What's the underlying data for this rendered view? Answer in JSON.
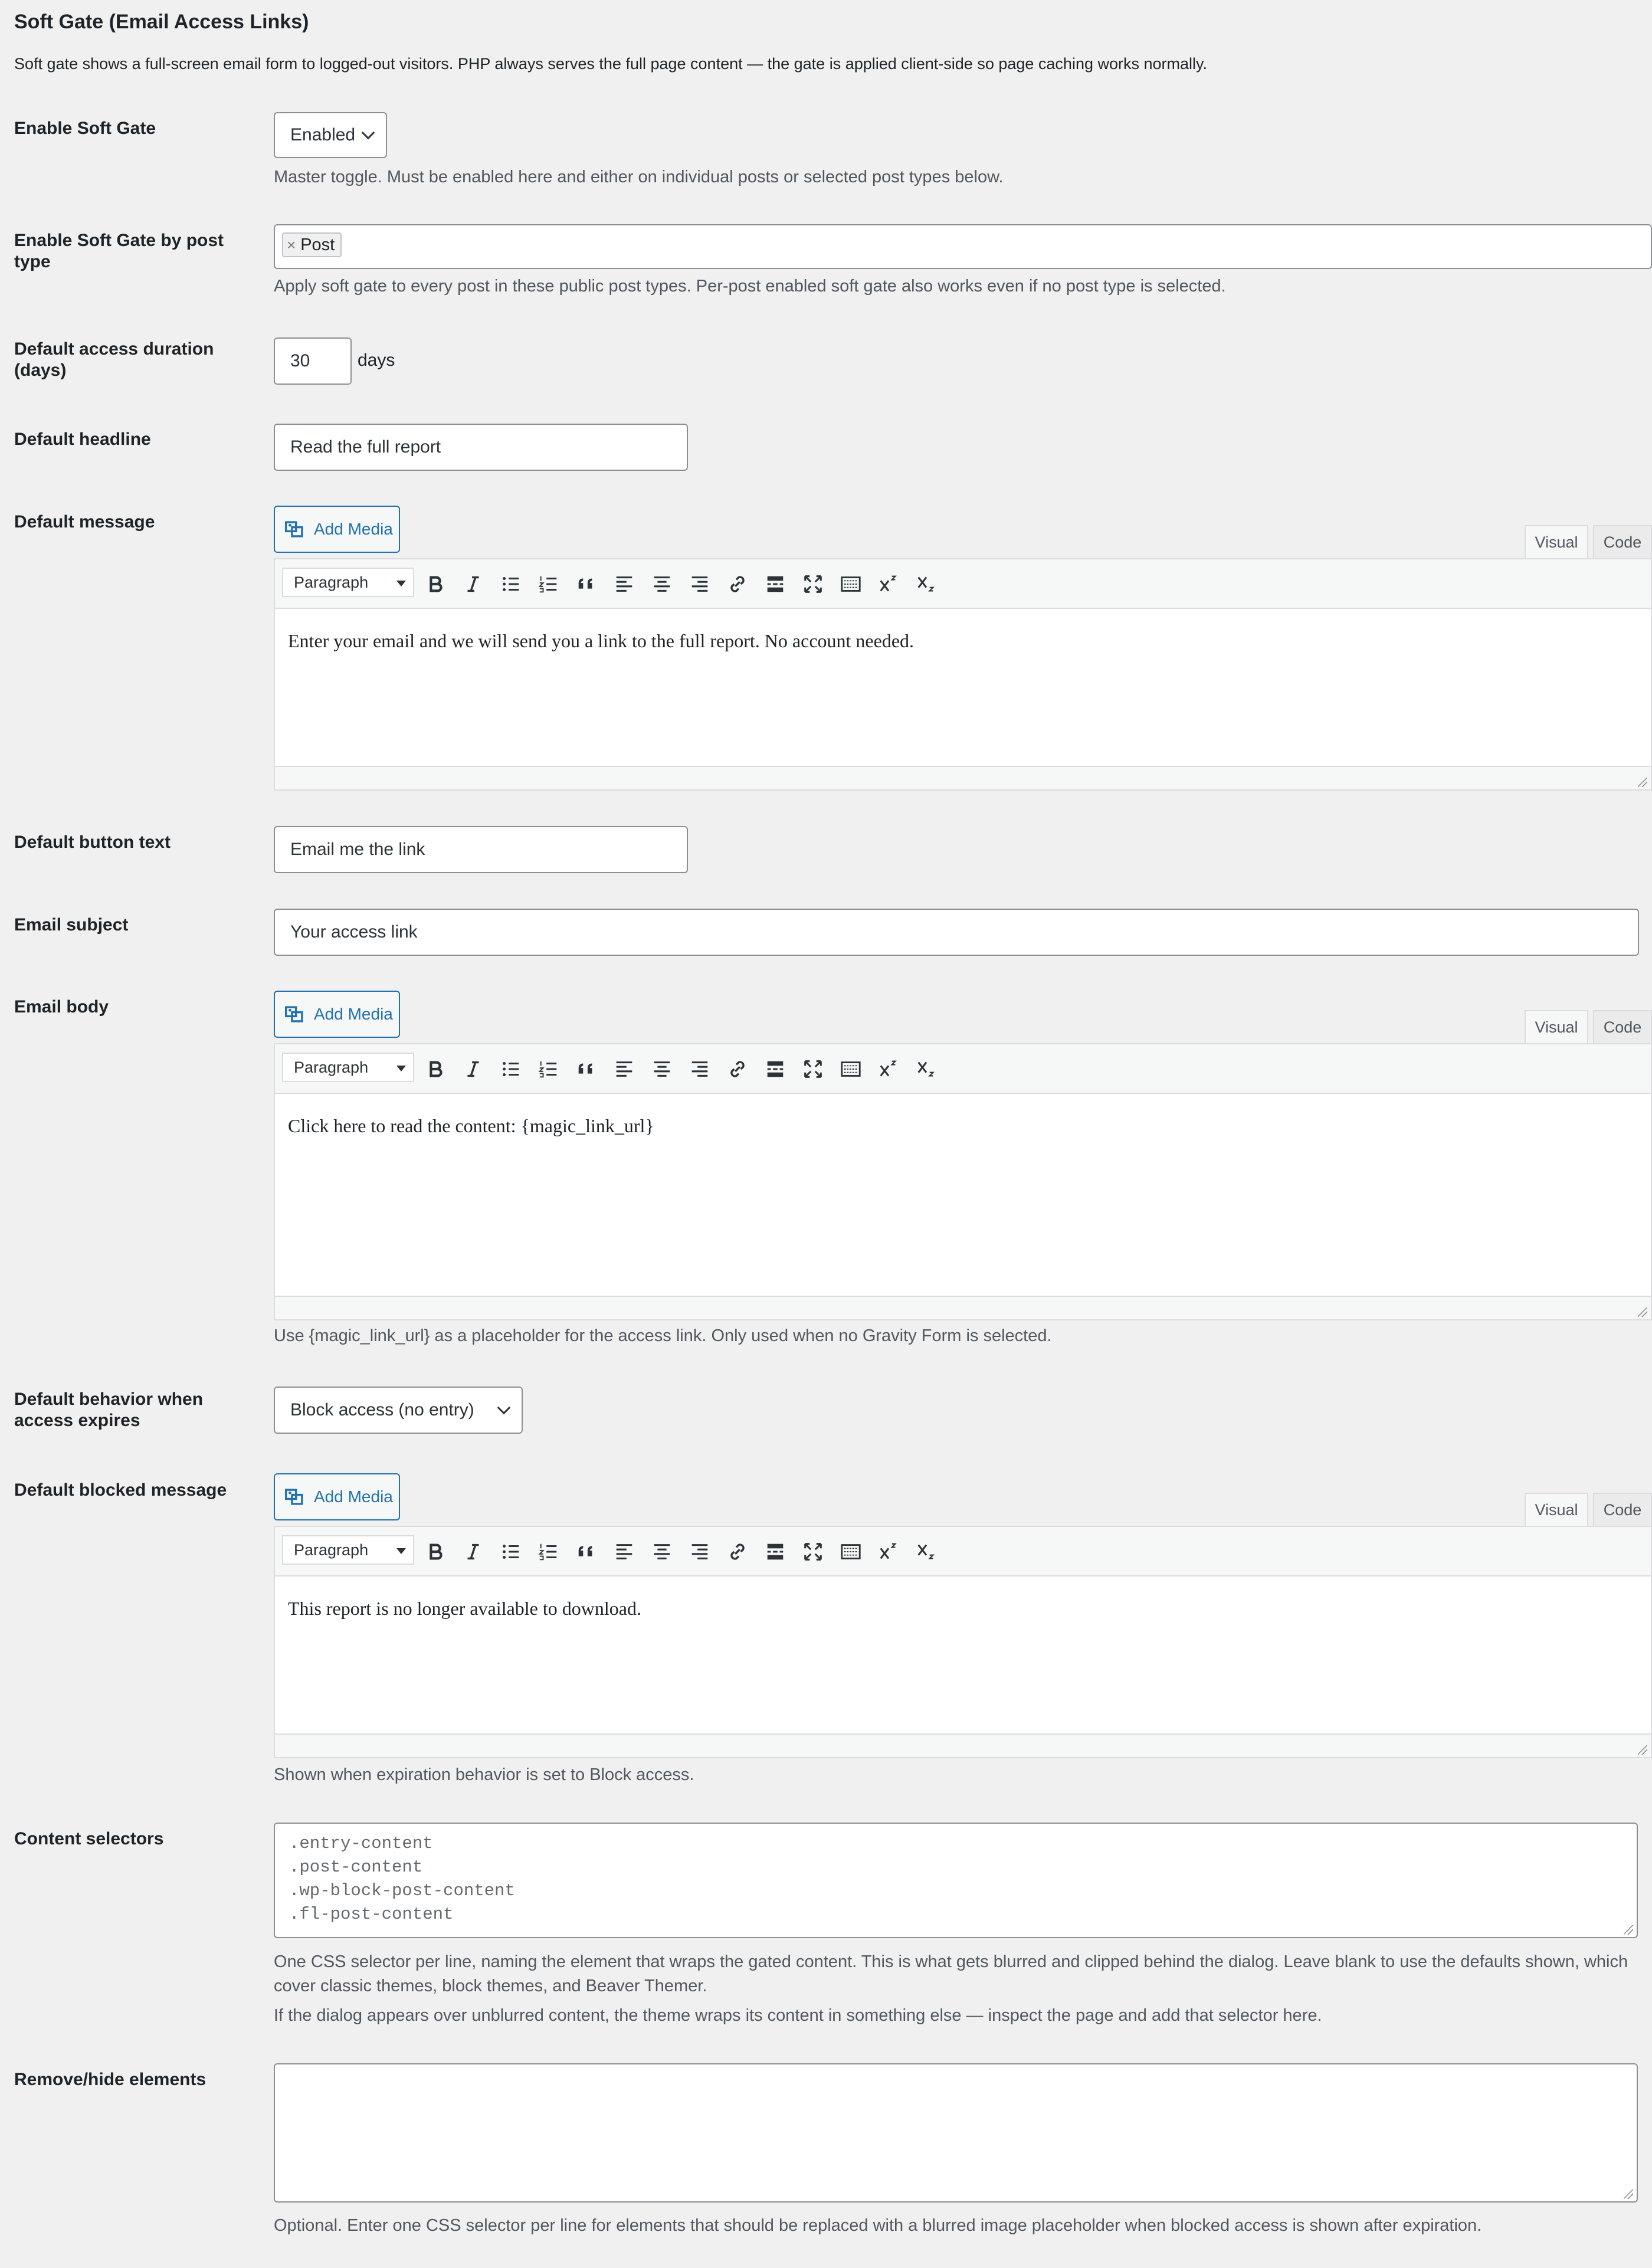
{
  "section": {
    "title": "Soft Gate (Email Access Links)",
    "description": "Soft gate shows a full-screen email form to logged-out visitors. PHP always serves the full page content — the gate is applied client-side so page caching works normally."
  },
  "enable_soft_gate": {
    "label": "Enable Soft Gate",
    "value": "Enabled",
    "description": "Master toggle. Must be enabled here and either on individual posts or selected post types below."
  },
  "post_type": {
    "label_line1": "Enable Soft Gate by post",
    "label_line2": "type",
    "tokens": [
      "Post"
    ],
    "token_remove": "×",
    "description": "Apply soft gate to every post in these public post types. Per-post enabled soft gate also works even if no post type is selected."
  },
  "duration": {
    "label_line1": "Default access duration",
    "label_line2": "(days)",
    "value": "30",
    "suffix": "days"
  },
  "headline": {
    "label": "Default headline",
    "value": "Read the full report"
  },
  "message": {
    "label": "Default message",
    "add_media": "Add Media",
    "tab_visual": "Visual",
    "tab_code": "Code",
    "format": "Paragraph",
    "content": "Enter your email and we will send you a link to the full report. No account needed."
  },
  "button_text": {
    "label": "Default button text",
    "value": "Email me the link"
  },
  "email_subject": {
    "label": "Email subject",
    "value": "Your access link"
  },
  "email_body": {
    "label": "Email body",
    "add_media": "Add Media",
    "tab_visual": "Visual",
    "tab_code": "Code",
    "format": "Paragraph",
    "content": "Click here to read the content: {magic_link_url}",
    "description": "Use {magic_link_url} as a placeholder for the access link. Only used when no Gravity Form is selected."
  },
  "expire_behavior": {
    "label_line1": "Default behavior when",
    "label_line2": "access expires",
    "value": "Block access (no entry)"
  },
  "blocked_message": {
    "label": "Default blocked message",
    "add_media": "Add Media",
    "tab_visual": "Visual",
    "tab_code": "Code",
    "format": "Paragraph",
    "content": "This report is no longer available to download.",
    "description": "Shown when expiration behavior is set to Block access."
  },
  "content_selectors": {
    "label": "Content selectors",
    "lines": [
      ".entry-content",
      ".post-content",
      ".wp-block-post-content",
      ".fl-post-content"
    ],
    "description_line1": "One CSS selector per line, naming the element that wraps the gated content. This is what gets blurred and clipped behind the dialog. Leave blank to use the defaults shown, which",
    "description_line2": "cover classic themes, block themes, and Beaver Themer.",
    "description2": "If the dialog appears over unblurred content, the theme wraps its content in something else — inspect the page and add that selector here."
  },
  "remove_elements": {
    "label": "Remove/hide elements",
    "value": "",
    "description": "Optional. Enter one CSS selector per line for elements that should be replaced with a blurred image placeholder when blocked access is shown after expiration."
  },
  "colors": {
    "accent": "#2271b1",
    "text": "#1d2327",
    "muted": "#50575e",
    "background": "#f0f0f1"
  }
}
